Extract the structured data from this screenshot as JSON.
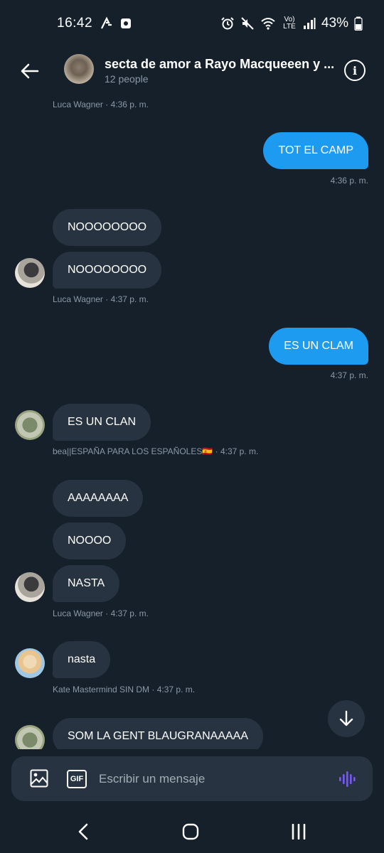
{
  "status_bar": {
    "time": "16:42",
    "battery": "43%",
    "network": "Vo) LTE"
  },
  "header": {
    "title": "secta de amor a Rayo Macqueeen y ...",
    "subtitle": "12 people"
  },
  "messages": [
    {
      "kind": "meta",
      "text": "Luca Wagner · 4:36 p. m."
    },
    {
      "kind": "out",
      "text": "TOT EL CAMP"
    },
    {
      "kind": "meta",
      "text": "4:36 p. m."
    },
    {
      "kind": "in",
      "text": "NOOOOOOOO"
    },
    {
      "kind": "in",
      "text": "NOOOOOOOO"
    },
    {
      "kind": "meta",
      "text": "Luca Wagner · 4:37 p. m."
    },
    {
      "kind": "out",
      "text": "ES UN CLAM"
    },
    {
      "kind": "meta",
      "text": "4:37 p. m."
    },
    {
      "kind": "in",
      "text": "ES UN CLAN"
    },
    {
      "kind": "meta",
      "text": "bea||ESPAÑA PARA LOS ESPAÑOLES🇪🇸 · 4:37 p. m."
    },
    {
      "kind": "in",
      "text": "AAAAAAAA"
    },
    {
      "kind": "in",
      "text": "NOOOO"
    },
    {
      "kind": "in",
      "text": "NASTA"
    },
    {
      "kind": "meta",
      "text": "Luca Wagner · 4:37 p. m."
    },
    {
      "kind": "in",
      "text": "nasta"
    },
    {
      "kind": "meta",
      "text": "Kate Mastermind SIN DM · 4:37 p. m."
    },
    {
      "kind": "in",
      "text": "SOM LA GENT BLAUGRANAAAAA"
    }
  ],
  "composer": {
    "placeholder": "Escribir un mensaje",
    "gif_label": "GIF"
  },
  "colors": {
    "background": "#15202b",
    "bubble_in": "#273340",
    "bubble_out": "#1d9bf0",
    "meta": "#8b98a5",
    "voice_accent": "#7856ff"
  },
  "icons": {
    "back": "arrow-left-icon",
    "info": "info-icon",
    "scroll_down": "arrow-down-icon",
    "image": "image-icon",
    "voice": "voice-waveform-icon",
    "nav": [
      "nav-back-icon",
      "nav-home-icon",
      "nav-recents-icon"
    ]
  }
}
